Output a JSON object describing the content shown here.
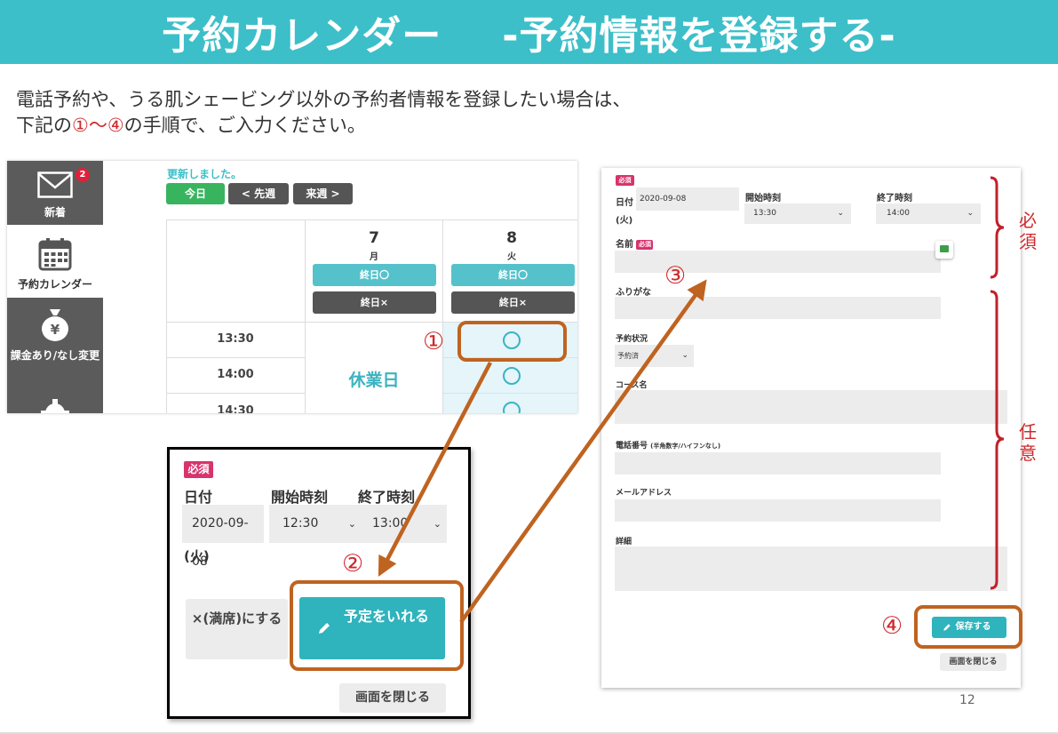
{
  "banner": {
    "title": "予約カレンダー",
    "subtitle": "-予約情報を登録する-"
  },
  "intro": {
    "line1": "電話予約や、うる肌シェービング以外の予約者情報を登録したい場合は、",
    "line2_pre": "下記の",
    "line2_steps": "①〜④",
    "line2_post": "の手順で、ご入力ください。"
  },
  "calendar": {
    "sidebar": [
      {
        "label": "新着",
        "icon": "envelope-icon",
        "badge": "2"
      },
      {
        "label": "予約カレンダー",
        "icon": "calendar-icon"
      },
      {
        "label": "課金あり/なし変更",
        "icon": "money-bag-icon"
      },
      {
        "label": "",
        "icon": "gear-icon"
      }
    ],
    "message": "更新しました。",
    "nav": {
      "today": "今日",
      "prev": "< 先週",
      "next": "来週 >"
    },
    "days": [
      {
        "num": "7",
        "dow": "月",
        "allday_open": "終日〇",
        "allday_closed": "終日×",
        "holiday": "休業日"
      },
      {
        "num": "8",
        "dow": "火",
        "allday_open": "終日〇",
        "allday_closed": "終日×"
      }
    ],
    "times": [
      "13:30",
      "14:00",
      "14:30"
    ],
    "slot_mark": "〇"
  },
  "popup": {
    "required_tag": "必須",
    "date_label": "日付",
    "start_label": "開始時刻",
    "end_label": "終了時刻",
    "date_value": "2020-09-08",
    "date_weekday": "(火)",
    "start_value": "12:30",
    "end_value": "13:00",
    "full_button": "×(満席)にする",
    "reserve_button": "予定をいれる",
    "close_button": "画面を閉じる"
  },
  "form": {
    "required_tag": "必須",
    "date_label": "日付",
    "date_weekday": "(火)",
    "date_value": "2020-09-08",
    "start_label": "開始時刻",
    "start_value": "13:30",
    "end_label": "終了時刻",
    "end_value": "14:00",
    "name_label": "名前",
    "name_tag": "必須",
    "kana_label": "ふりがな",
    "status_label": "予約状況",
    "status_value": "予約済",
    "course_label": "コース名",
    "phone_label": "電話番号",
    "phone_hint": "(半角数字/ハイフンなし)",
    "email_label": "メールアドレス",
    "detail_label": "詳細",
    "save_button": "保存する",
    "close_button": "画面を閉じる"
  },
  "steps": [
    "①",
    "②",
    "③",
    "④"
  ],
  "labels": {
    "required": "必須",
    "optional": "任意"
  },
  "page_number": "12",
  "colors": {
    "banner": "#3cbfc9",
    "accent_orange": "#bf6320",
    "step_red": "#d0282b",
    "teal_button": "#2fb3bc",
    "required_tag": "#d8336c"
  }
}
